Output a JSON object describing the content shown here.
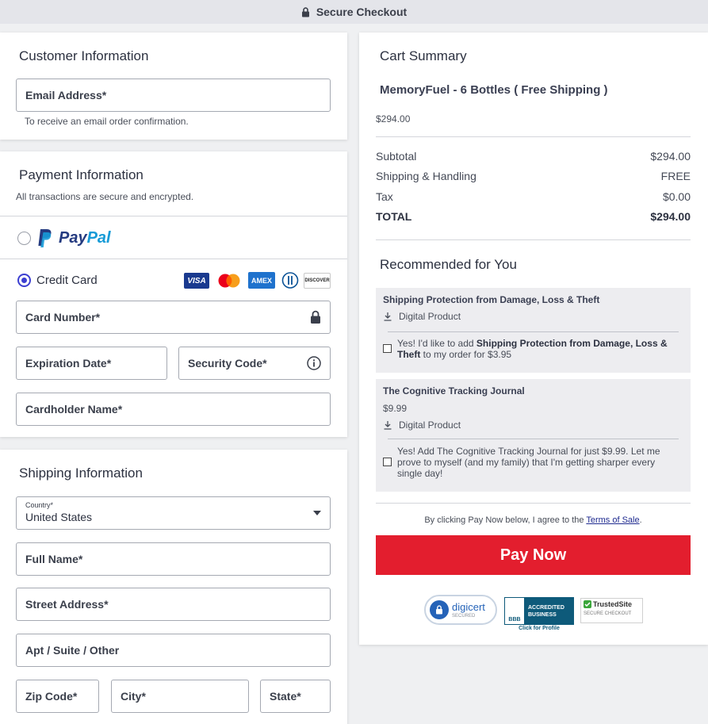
{
  "header": {
    "title": "Secure Checkout"
  },
  "customer": {
    "title": "Customer Information",
    "email_label": "Email Address*",
    "email_hint": "To receive an email order confirmation."
  },
  "payment": {
    "title": "Payment Information",
    "subtitle": "All transactions are secure and encrypted.",
    "paypal_label": "PayPal",
    "credit_label": "Credit Card",
    "card_brands": [
      "VISA",
      "Mastercard",
      "AMEX",
      "Diners",
      "DISCOVER"
    ],
    "card_number_label": "Card Number*",
    "expiration_label": "Expiration Date*",
    "security_label": "Security Code*",
    "cardholder_label": "Cardholder Name*",
    "selected_method": "credit_card"
  },
  "shipping": {
    "title": "Shipping Information",
    "country_label": "Country*",
    "country_value": "United States",
    "full_name_label": "Full Name*",
    "street_label": "Street Address*",
    "apt_label": "Apt / Suite / Other",
    "zip_label": "Zip Code*",
    "city_label": "City*",
    "state_label": "State*"
  },
  "cart": {
    "title": "Cart Summary",
    "product_name": "MemoryFuel - 6 Bottles ( Free Shipping )",
    "product_price": "$294.00",
    "subtotal_label": "Subtotal",
    "subtotal_value": "$294.00",
    "shipping_label": "Shipping & Handling",
    "shipping_value": "FREE",
    "tax_label": "Tax",
    "tax_value": "$0.00",
    "total_label": "TOTAL",
    "total_value": "$294.00"
  },
  "recommended": {
    "title": "Recommended for You",
    "items": [
      {
        "name": "Shipping Protection from Damage, Loss & Theft",
        "type": "Digital Product",
        "offer_prefix": "Yes! I'd like to add ",
        "offer_bold": "Shipping Protection from Damage, Loss & Theft",
        "offer_suffix": " to my order for $3.95"
      },
      {
        "name": "The Cognitive Tracking Journal",
        "price": "$9.99",
        "type": "Digital Product",
        "offer": "Yes! Add The Cognitive Tracking Journal for just $9.99. Let me prove to myself (and my family) that I'm getting sharper every single day!"
      }
    ]
  },
  "terms": {
    "prefix": "By clicking Pay Now below, I agree to the ",
    "link": "Terms of Sale",
    "suffix": "."
  },
  "pay_button": "Pay Now",
  "badges": {
    "digicert": "digicert",
    "digicert_sub": "SECURED",
    "bbb_line1": "ACCREDITED",
    "bbb_line2": "BUSINESS",
    "bbb_link": "Click for Profile",
    "trusted": "TrustedSite",
    "trusted_sub": "SECURE CHECKOUT"
  },
  "colors": {
    "accent": "#3c3fd1",
    "pay_button": "#e31e2e",
    "paypal_dark": "#253b80",
    "paypal_light": "#179bd7"
  }
}
